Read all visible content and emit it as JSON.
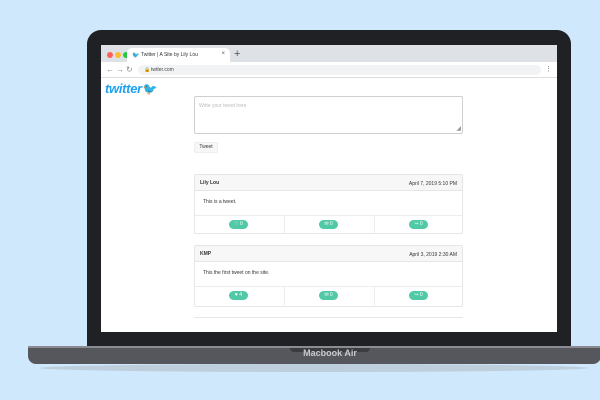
{
  "device": {
    "model_label": "Macbook Air"
  },
  "browser": {
    "tab_title": "Twitter | A Site by Lily Lou",
    "tab_icon": "twitter-bird-icon",
    "new_tab_symbol": "+",
    "close_symbol": "×",
    "url": "twtter.com",
    "nav": {
      "back": "←",
      "forward": "→",
      "reload": "↻",
      "menu": "⋮",
      "lock": "🔒"
    },
    "traffic_light_colors": [
      "#ff5f57",
      "#febc2e",
      "#28c840"
    ]
  },
  "page": {
    "logo_text": "twitter",
    "logo_bird": "🐦",
    "compose": {
      "placeholder": "Write your tweet here",
      "resize_glyph": "◢"
    },
    "tweet_button_label": "Tweet",
    "accent_color": "#50c9a6",
    "brand_color": "#1da1f2",
    "tweets": [
      {
        "author": "Lily Lou",
        "date": "April 7, 2019 5:10 PM",
        "text": "This is a tweet.",
        "actions": [
          {
            "icon": "heart-icon",
            "label": "♡ 0"
          },
          {
            "icon": "comment-icon",
            "label": "✉ 0"
          },
          {
            "icon": "retweet-icon",
            "label": "↪ 0"
          }
        ]
      },
      {
        "author": "KMP",
        "date": "April 3, 2019 2:30 AM",
        "text": "This the first tweet on the site.",
        "actions": [
          {
            "icon": "heart-icon",
            "label": "♥ 4"
          },
          {
            "icon": "comment-icon",
            "label": "✉ 0"
          },
          {
            "icon": "retweet-icon",
            "label": "↪ 0"
          }
        ]
      }
    ]
  }
}
